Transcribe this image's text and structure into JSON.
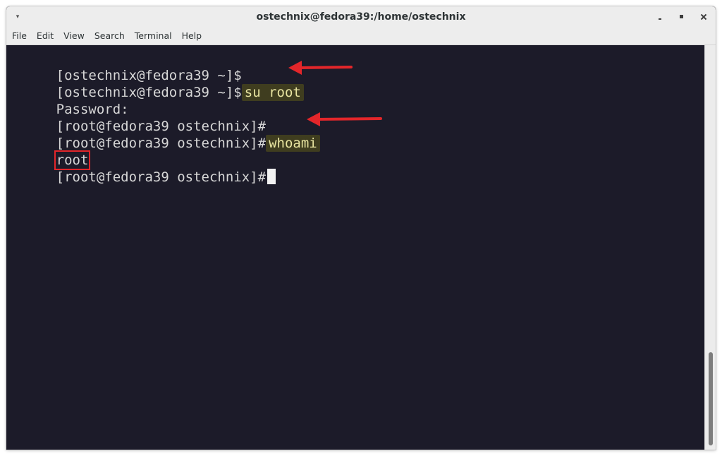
{
  "window": {
    "title": "ostechnix@fedora39:/home/ostechnix",
    "left_icon": "pin-icon",
    "controls": [
      "minimize-icon",
      "maximize-icon",
      "close-icon"
    ]
  },
  "menu": {
    "items": [
      {
        "label": "File"
      },
      {
        "label": "Edit"
      },
      {
        "label": "View"
      },
      {
        "label": "Search"
      },
      {
        "label": "Terminal"
      },
      {
        "label": "Help"
      }
    ]
  },
  "terminal": {
    "lines": [
      {
        "prompt": "[ostechnix@fedora39 ~]$",
        "command": ""
      },
      {
        "prompt": "[ostechnix@fedora39 ~]$",
        "command": "su root"
      },
      {
        "prompt": "Password:",
        "command": ""
      },
      {
        "prompt": "[root@fedora39 ostechnix]#",
        "command": ""
      },
      {
        "prompt": "[root@fedora39 ostechnix]#",
        "command": "whoami"
      },
      {
        "output": "root"
      },
      {
        "prompt": "[root@fedora39 ostechnix]#",
        "command": ""
      }
    ]
  },
  "annotations": {
    "arrow_color": "#e3262a",
    "highlight_color": "#3f3d1f"
  }
}
